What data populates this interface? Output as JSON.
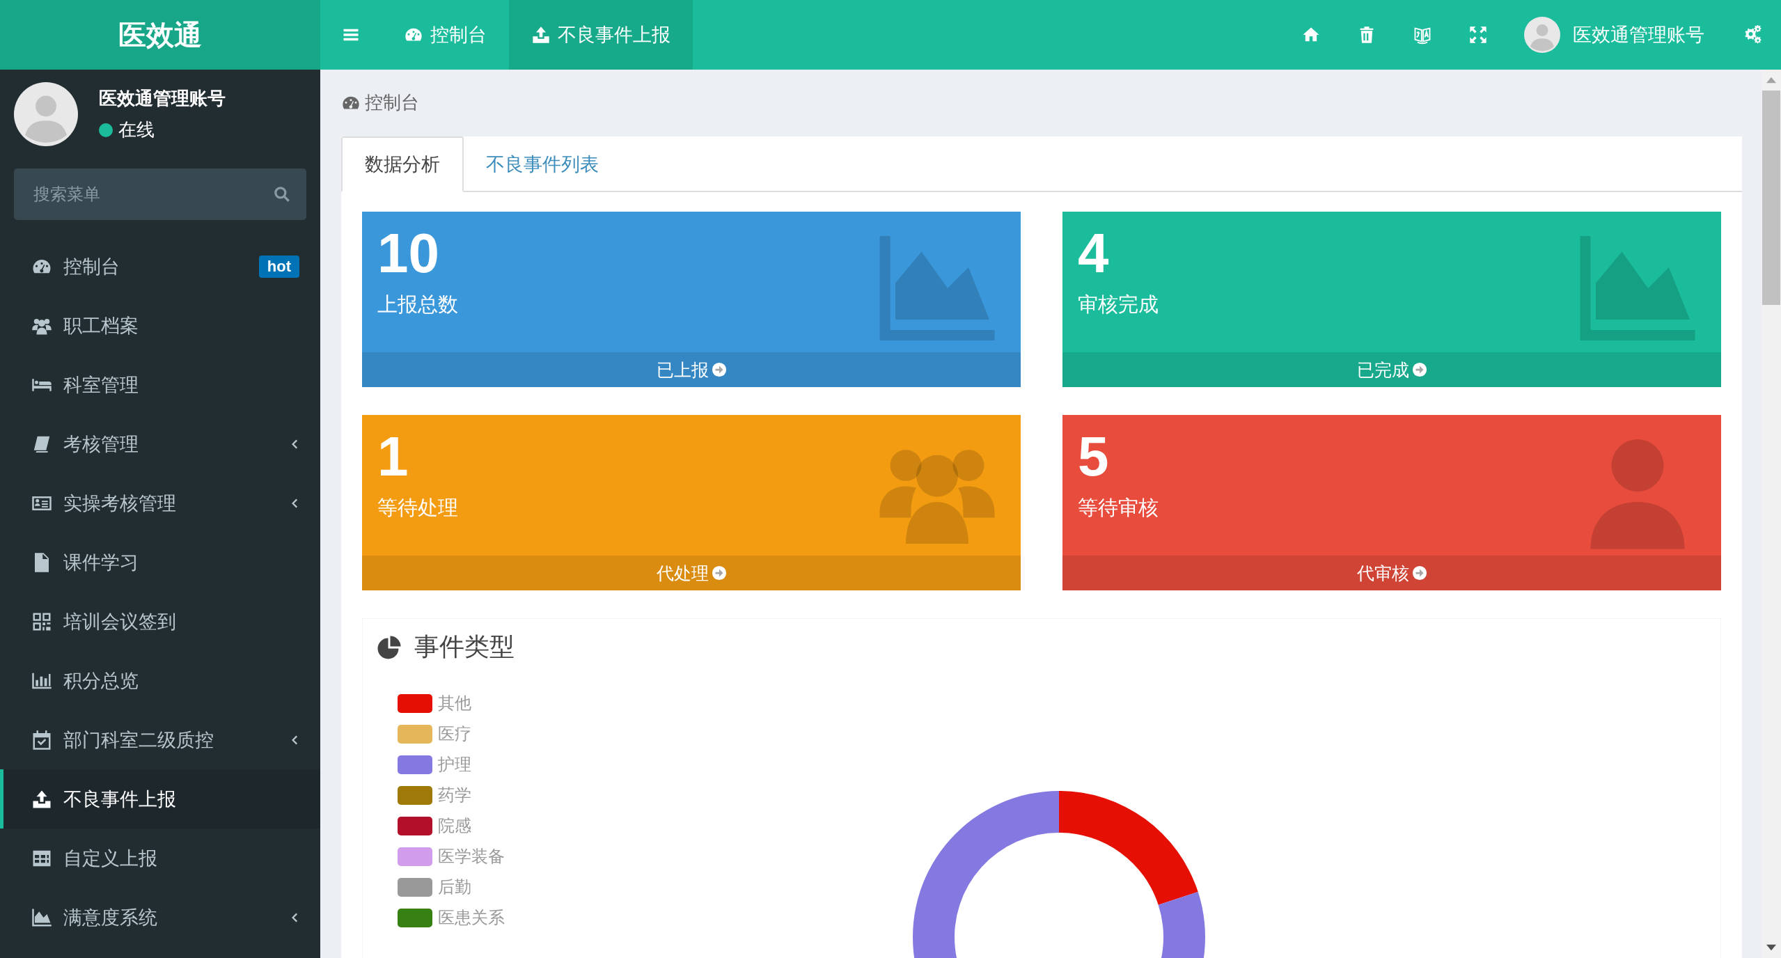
{
  "brand": "医效通",
  "topbar": {
    "items": [
      {
        "label": "控制台",
        "selected": false
      },
      {
        "label": "不良事件上报",
        "selected": true
      }
    ],
    "user": "医效通管理账号"
  },
  "sidebar": {
    "user": {
      "name": "医效通管理账号",
      "status": "在线"
    },
    "search": {
      "placeholder": "搜索菜单"
    },
    "items": [
      {
        "label": "控制台",
        "badge": "hot",
        "submenu": false,
        "selected": false
      },
      {
        "label": "职工档案",
        "submenu": false,
        "selected": false
      },
      {
        "label": "科室管理",
        "submenu": false,
        "selected": false
      },
      {
        "label": "考核管理",
        "submenu": true,
        "selected": false
      },
      {
        "label": "实操考核管理",
        "submenu": true,
        "selected": false
      },
      {
        "label": "课件学习",
        "submenu": false,
        "selected": false
      },
      {
        "label": "培训会议签到",
        "submenu": false,
        "selected": false
      },
      {
        "label": "积分总览",
        "submenu": false,
        "selected": false
      },
      {
        "label": "部门科室二级质控",
        "submenu": true,
        "selected": false
      },
      {
        "label": "不良事件上报",
        "submenu": false,
        "selected": true
      },
      {
        "label": "自定义上报",
        "submenu": false,
        "selected": false
      },
      {
        "label": "满意度系统",
        "submenu": true,
        "selected": false
      }
    ]
  },
  "breadcrumb": "控制台",
  "tabs": [
    {
      "label": "数据分析",
      "selected": true
    },
    {
      "label": "不良事件列表",
      "selected": false
    }
  ],
  "cards": [
    {
      "value": "10",
      "label": "上报总数",
      "link": "已上报",
      "color": "#3a97da"
    },
    {
      "value": "4",
      "label": "审核完成",
      "link": "已完成",
      "color": "#1bbc9b"
    },
    {
      "value": "1",
      "label": "等待处理",
      "link": "代处理",
      "color": "#f39c12"
    },
    {
      "value": "5",
      "label": "等待审核",
      "link": "代审核",
      "color": "#e74c3c"
    }
  ],
  "chart_panel": {
    "title": "事件类型",
    "chart_data": {
      "type": "donut",
      "categories": [
        "其他",
        "医疗",
        "护理",
        "药学",
        "院感",
        "医学装备",
        "后勤",
        "医患关系"
      ],
      "legend": "left",
      "values": [
        20,
        0,
        80,
        0,
        0,
        0,
        0,
        0
      ]
    }
  }
}
